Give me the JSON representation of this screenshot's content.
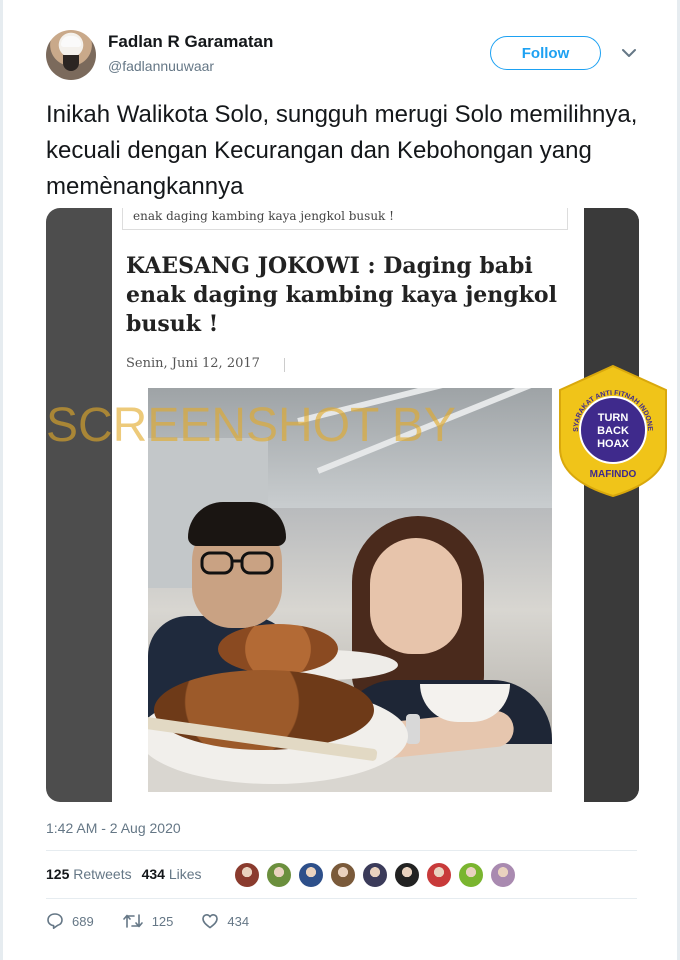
{
  "tweet": {
    "author_name": "Fadlan R Garamatan",
    "author_handle": "@fadlannuuwaar",
    "follow_label": "Follow",
    "text": "Inikah Walikota Solo, sungguh merugi Solo memilihnya, kecuali dengan Kecurangan dan Kebohongan yang memènangkannya",
    "timestamp": "1:42 AM - 2 Aug 2020"
  },
  "media": {
    "article_strip": "enak daging kambing kaya jengkol busuk !",
    "article_title": "KAESANG JOKOWI : Daging babi enak daging kambing kaya jengkol busuk !",
    "article_date": "Senin, Juni 12, 2017",
    "watermark": "SCREENSHOT BY",
    "badge": {
      "ring_text": "MASYARAKAT ANTI FITNAH INDONESIA",
      "center_lines": [
        "TURN",
        "BACK",
        "HOAX"
      ],
      "bottom_text": "MAFINDO",
      "colors": {
        "ring": "#f0c419",
        "center": "#3f2a8c",
        "text": "#ffffff"
      }
    }
  },
  "stats": {
    "retweets_count": "125",
    "retweets_label": "Retweets",
    "likes_count": "434",
    "likes_label": "Likes",
    "liker_colors": [
      "#8a3b2e",
      "#6b8f3d",
      "#2d4f8a",
      "#7a5a3a",
      "#3b3b5a",
      "#222222",
      "#c83a3a",
      "#7ab52f",
      "#a98ab0"
    ]
  },
  "actions": {
    "replies": "689",
    "retweets": "125",
    "likes": "434"
  },
  "colors": {
    "accent": "#1da1f2",
    "text_secondary": "#657786",
    "watermark": "#e2aa28"
  }
}
